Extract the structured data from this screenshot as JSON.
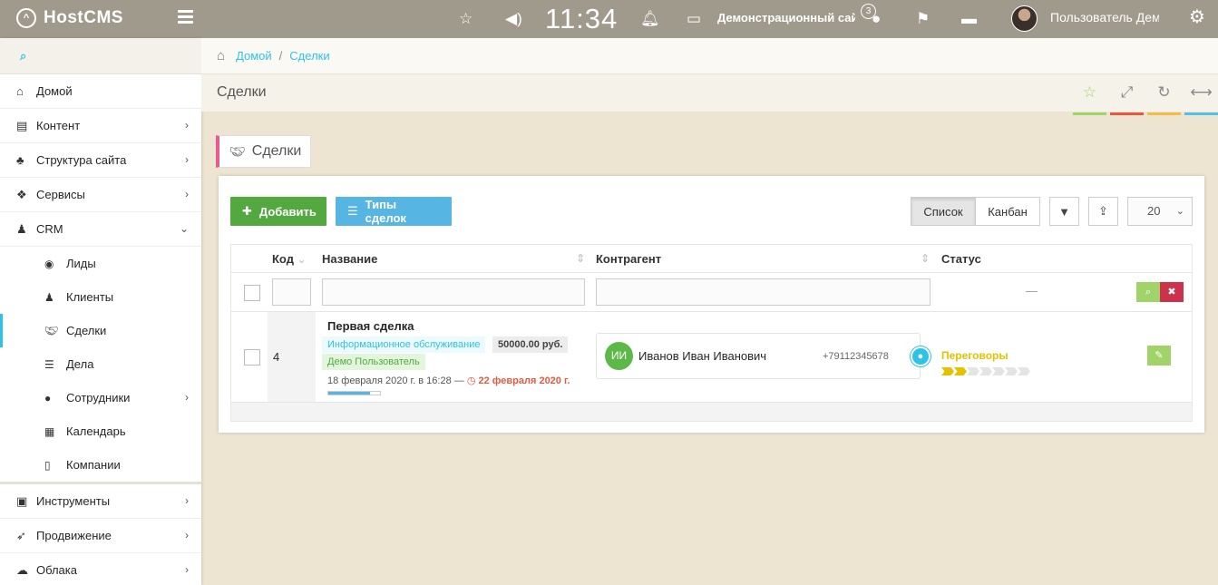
{
  "topbar": {
    "logo_text": "HostCMS",
    "time": "11:34",
    "site_name": "Демонстрационный сайт",
    "site_badge": "3",
    "user_name": "Пользователь Демо"
  },
  "sidebar": {
    "items": [
      {
        "label": "Домой"
      },
      {
        "label": "Контент"
      },
      {
        "label": "Структура сайта"
      },
      {
        "label": "Сервисы"
      },
      {
        "label": "CRM"
      }
    ],
    "crm_sub": [
      {
        "label": "Лиды"
      },
      {
        "label": "Клиенты"
      },
      {
        "label": "Сделки"
      },
      {
        "label": "Дела"
      },
      {
        "label": "Сотрудники"
      },
      {
        "label": "Календарь"
      },
      {
        "label": "Компании"
      }
    ],
    "bottom_items": [
      {
        "label": "Инструменты"
      },
      {
        "label": "Продвижение"
      },
      {
        "label": "Облака"
      }
    ]
  },
  "breadcrumb": {
    "home": "Домой",
    "sep": "/",
    "current": "Сделки"
  },
  "page": {
    "title": "Сделки"
  },
  "header_tabs": {
    "colors": [
      "#a0d468",
      "#e9573f",
      "#f6bb42",
      "#4fc1e9"
    ]
  },
  "widget": {
    "tab_label": "Сделки",
    "add_label": "Добавить",
    "types_label": "Типы сделок",
    "view_list": "Список",
    "view_kanban": "Канбан",
    "page_size": "20"
  },
  "table": {
    "columns": {
      "code": "Код",
      "name": "Название",
      "counterparty": "Контрагент",
      "status": "Статус"
    },
    "filter_status_dash": "—",
    "rows": [
      {
        "code": "4",
        "title": "Первая сделка",
        "tag_type": "Информационное обслуживание",
        "amount": "50000.00 руб.",
        "user": "Демо Пользователь",
        "created": "18 февраля 2020 г. в 16:28 —",
        "deadline": "22 февраля 2020 г.",
        "progress": 0.8,
        "cp_initials": "ИИ",
        "cp_name": "Иванов Иван Иванович",
        "cp_phone": "+79112345678",
        "status": "Переговоры",
        "status_step": 2,
        "status_steps": 7
      }
    ]
  }
}
